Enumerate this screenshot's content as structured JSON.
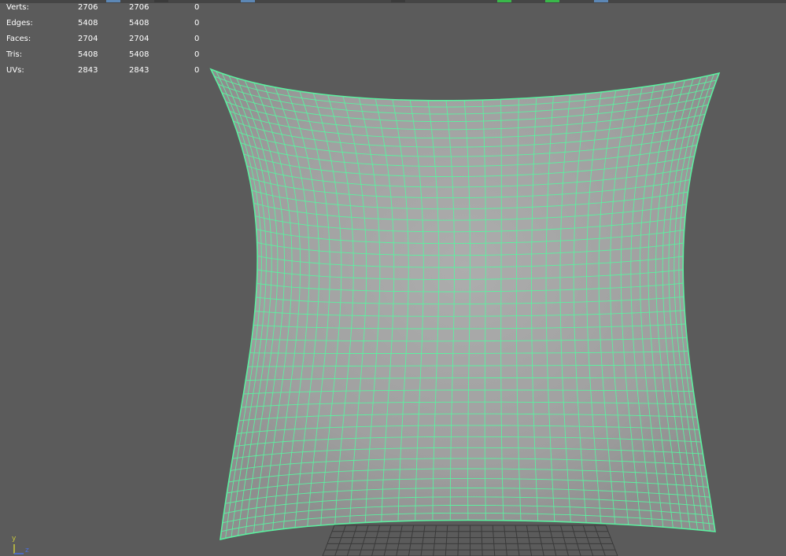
{
  "hud": {
    "rows": [
      {
        "label": "Verts:",
        "c1": "2706",
        "c2": "2706",
        "c3": "0"
      },
      {
        "label": "Edges:",
        "c1": "5408",
        "c2": "5408",
        "c3": "0"
      },
      {
        "label": "Faces:",
        "c1": "2704",
        "c2": "2704",
        "c3": "0"
      },
      {
        "label": "Tris:",
        "c1": "5408",
        "c2": "5408",
        "c3": "0"
      },
      {
        "label": "UVs:",
        "c1": "2843",
        "c2": "2843",
        "c3": "0"
      }
    ]
  },
  "axis": {
    "y_label": "y",
    "z_label": "z",
    "y_color": "#c9c93c",
    "z_color": "#4a6fdd",
    "x_color": "#d23c3c"
  },
  "colors": {
    "viewport_bg": "#5b5b5b",
    "mesh_fill": "#a0a0a0",
    "wireframe": "#5cf0a0",
    "grid": "#3a3a3a"
  },
  "icons": {
    "axis_indicator": "axis-gizmo-icon"
  }
}
